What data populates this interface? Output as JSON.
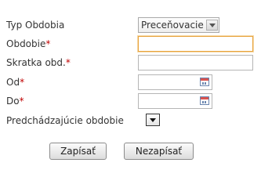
{
  "form": {
    "type_label": "Typ Obdobia",
    "type_value": "Preceňovacie",
    "period_label": "Obdobie",
    "short_label": "Skratka obd.",
    "from_label": "Od",
    "to_label": "Do",
    "previous_label": "Predchádzajúcie obdobie",
    "required_mark": "*",
    "period_value": "",
    "short_value": "",
    "from_value": "",
    "to_value": ""
  },
  "buttons": {
    "save_label": "Zapísať",
    "cancel_label": "Nezapísať"
  },
  "colors": {
    "required": "#c00000",
    "focus_border": "#e8a33c"
  },
  "icons": {
    "calendar": "calendar-icon",
    "dropdown": "chevron-down-icon"
  }
}
